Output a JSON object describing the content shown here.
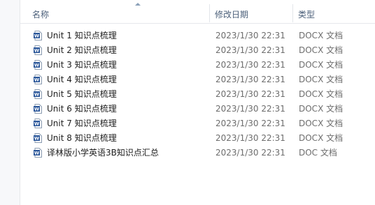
{
  "columns": {
    "name": "名称",
    "date": "修改日期",
    "type": "类型"
  },
  "files": [
    {
      "name": "Unit 1 知识点梳理",
      "date": "2023/1/30 22:31",
      "type": "DOCX 文档",
      "icon": "word-document-icon"
    },
    {
      "name": "Unit 2 知识点梳理",
      "date": "2023/1/30 22:31",
      "type": "DOCX 文档",
      "icon": "word-document-icon"
    },
    {
      "name": "Unit 3 知识点梳理",
      "date": "2023/1/30 22:31",
      "type": "DOCX 文档",
      "icon": "word-document-icon"
    },
    {
      "name": "Unit 4 知识点梳理",
      "date": "2023/1/30 22:31",
      "type": "DOCX 文档",
      "icon": "word-document-icon"
    },
    {
      "name": "Unit 5 知识点梳理",
      "date": "2023/1/30 22:31",
      "type": "DOCX 文档",
      "icon": "word-document-icon"
    },
    {
      "name": "Unit 6 知识点梳理",
      "date": "2023/1/30 22:31",
      "type": "DOCX 文档",
      "icon": "word-document-icon"
    },
    {
      "name": "Unit 7 知识点梳理",
      "date": "2023/1/30 22:31",
      "type": "DOCX 文档",
      "icon": "word-document-icon"
    },
    {
      "name": "Unit 8 知识点梳理",
      "date": "2023/1/30 22:31",
      "type": "DOCX 文档",
      "icon": "word-document-icon"
    },
    {
      "name": "译林版小学英语3B知识点汇总",
      "date": "2023/1/30 22:31",
      "type": "DOC 文档",
      "icon": "word-document-icon"
    }
  ],
  "colors": {
    "header_text": "#4c607a",
    "icon_blue": "#2b579a"
  }
}
